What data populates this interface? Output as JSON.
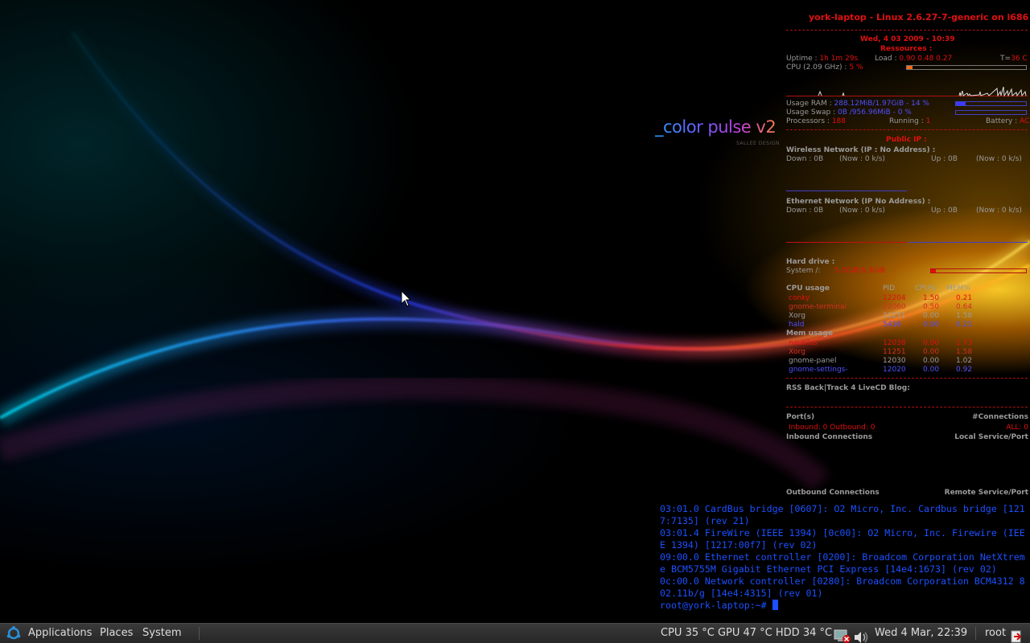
{
  "wallpaper": {
    "brand_word": "_color pulse v2",
    "brand_sub": "SALLEE DESIGN"
  },
  "conky": {
    "header": "york-laptop - Linux 2.6.27-7-generic on i686",
    "datetime": "Wed,  4 03 2009 - 10:39",
    "resources_title": "Ressources :",
    "uptime_label": "Uptime :",
    "uptime_value": "1h 1m 29s",
    "load_label": "Load :",
    "load_value": "0.90 0.48 0.27",
    "temp_label": "T=",
    "temp_value": "36",
    "temp_unit": "C",
    "cpu_label": "CPU (2.09 GHz) :",
    "cpu_value": "5",
    "cpu_unit": "%",
    "cpu_percent": 5,
    "ram_label": "Usage RAM :",
    "ram_value": "288.12MiB/1.97GiB",
    "ram_percent_text": "- 14 %",
    "ram_percent": 14,
    "swap_label": "Usage Swap :",
    "swap_value": "0B",
    "swap_total": "/956.96MiB - 0  %",
    "swap_percent": 0,
    "processes_label": "Processors :",
    "processes_value": "188",
    "running_label": "Running :",
    "running_value": "1",
    "battery_label": "Battery :",
    "battery_value": "AC",
    "public_ip_label": "Public IP :",
    "wireless_title": "Wireless Network (IP : No Address) :",
    "wireless_down": "Down : 0B",
    "wireless_down_now": "(Now : 0    k/s)",
    "wireless_up": "Up : 0B",
    "wireless_up_now": "(Now : 0    k/s)",
    "ethernet_title": "Ethernet Network (IP No Address) :",
    "ethernet_down": "Down : 0B",
    "ethernet_down_now": "(Now : 0    k/s)",
    "ethernet_up": "Up : 0B",
    "ethernet_up_now": "(Now : 0    k/s)",
    "hdd_title": "Hard drive :",
    "hdd_system_label": "System /:",
    "hdd_system_value": "5.2GiB/8.3GiB",
    "hdd_percent": 5,
    "cpu_usage_title": "CPU usage",
    "col_pid": "PID",
    "col_cpu": "CPU%",
    "col_mem": "MEM%",
    "cpu_procs": [
      {
        "name": "conky",
        "pid": "12204",
        "cpu": "1.50",
        "mem": "0.21",
        "color": "#e01010"
      },
      {
        "name": "gnome-terminal",
        "pid": "12060",
        "cpu": "0.50",
        "mem": "0.64",
        "color": "#d03020"
      },
      {
        "name": "Xorg",
        "pid": "11251",
        "cpu": "0.00",
        "mem": "1.58",
        "color": "#9a9a9a"
      },
      {
        "name": "hald",
        "pid": "5416",
        "cpu": "0.00",
        "mem": "0.21",
        "color": "#5050ff"
      }
    ],
    "mem_usage_title": "Mem usage",
    "mem_procs": [
      {
        "name": "nautilus",
        "pid": "12038",
        "cpu": "0.00",
        "mem": "1.73",
        "color": "#e01010"
      },
      {
        "name": "Xorg",
        "pid": "11251",
        "cpu": "0.00",
        "mem": "1.58",
        "color": "#d03020"
      },
      {
        "name": "gnome-panel",
        "pid": "12030",
        "cpu": "0.00",
        "mem": "1.02",
        "color": "#9a9a9a"
      },
      {
        "name": "gnome-settings-",
        "pid": "12020",
        "cpu": "0.00",
        "mem": "0.92",
        "color": "#5050ff"
      }
    ],
    "rss_title": "RSS Back|Track 4 LiveCD Blog:",
    "ports_title": "Port(s)",
    "connections_title": "#Connections",
    "inbound_outbound": "Inbound: 0  Outbound: 0",
    "all_connections": "ALL: 0",
    "inbound_connections": "Inbound Connections",
    "local_service_port": "Local Service/Port",
    "outbound_connections": "Outbound Connections",
    "remote_service_port": "Remote Service/Port"
  },
  "terminal": {
    "lines": [
      "03:01.0 CardBus bridge [0607]: O2 Micro, Inc. Cardbus bridge [121",
      "7:7135] (rev 21)",
      "03:01.4 FireWire (IEEE 1394) [0c00]: O2 Micro, Inc. Firewire (IEE",
      "E 1394) [1217:00f7] (rev 02)",
      "09:00.0 Ethernet controller [0200]: Broadcom Corporation NetXtrem",
      "e BCM5755M Gigabit Ethernet PCI Express [14e4:1673] (rev 02)",
      "0c:00.0 Network controller [0280]: Broadcom Corporation BCM4312 8",
      "02.11b/g [14e4:4315] (rev 01)"
    ],
    "prompt": "root@york-laptop:~# "
  },
  "panel": {
    "applications": "Applications",
    "places": "Places",
    "system": "System",
    "sensors": "CPU 35 °C GPU 47 °C HDD 34 °C",
    "clock": "Wed  4 Mar, 22:39",
    "user": "root"
  },
  "colors": {
    "conky_red": "#e01010",
    "conky_orange": "#ff6a10",
    "conky_blue": "#5050ff",
    "terminal_blue": "#1c50ff",
    "panel_bg": "#2f2f2f"
  }
}
